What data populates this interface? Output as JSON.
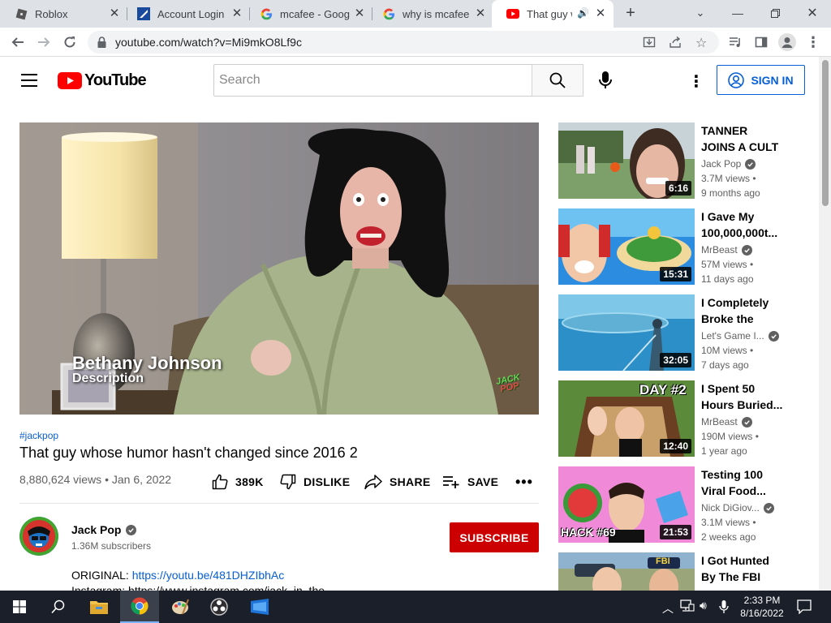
{
  "browser": {
    "tabs": [
      {
        "title": "Roblox"
      },
      {
        "title": "Account Login"
      },
      {
        "title": "mcafee - Google Search"
      },
      {
        "title": "why is mcafee o"
      },
      {
        "title": "That guy wh"
      }
    ],
    "url": "youtube.com/watch?v=Mi9mkO8Lf9c"
  },
  "header": {
    "logo_text": "YouTube",
    "search_placeholder": "Search",
    "signin_label": "SIGN IN"
  },
  "video": {
    "overlay_name": "Bethany Johnson",
    "overlay_sub": "Description",
    "watermark_top": "JACK",
    "watermark_bottom": "POP",
    "hashtag": "#jackpop",
    "title": "That guy whose humor hasn't changed since 2016 2",
    "views_date": "8,880,624 views • Jan 6, 2022",
    "likes": "389K",
    "dislike_label": "DISLIKE",
    "share_label": "SHARE",
    "save_label": "SAVE"
  },
  "channel": {
    "name": "Jack Pop",
    "subscribers": "1.36M subscribers",
    "subscribe_label": "SUBSCRIBE"
  },
  "description": {
    "line1_label": "ORIGINAL: ",
    "line1_link": "https://youtu.be/481DHZIbhAc",
    "line2": "Instagram: https://www.instagram.com/jack_in_the"
  },
  "recommended": [
    {
      "title": "TANNER JOINS A CULT",
      "channel": "Jack Pop",
      "views": "3.7M views •",
      "age": "9 months ago",
      "duration": "6:16",
      "verified": true
    },
    {
      "title": "I Gave My 100,000,000t...",
      "channel": "MrBeast",
      "views": "57M views •",
      "age": "11 days ago",
      "duration": "15:31",
      "verified": true
    },
    {
      "title": "I Completely Broke the Enti...",
      "channel": "Let's Game I...",
      "views": "10M views •",
      "age": "7 days ago",
      "duration": "32:05",
      "verified": true
    },
    {
      "title": "I Spent 50 Hours Buried...",
      "channel": "MrBeast",
      "views": "190M views •",
      "age": "1 year ago",
      "duration": "12:40",
      "verified": true,
      "thumb_text": "DAY #2"
    },
    {
      "title": "Testing 100 Viral Food...",
      "channel": "Nick DiGiov...",
      "views": "3.1M views •",
      "age": "2 weeks ago",
      "duration": "21:53",
      "verified": true,
      "thumb_text": "HACK #69"
    },
    {
      "title": "I Got Hunted By The FBI",
      "channel": "",
      "views": "",
      "age": "",
      "duration": "",
      "verified": false,
      "thumb_text": "FBI"
    }
  ],
  "taskbar": {
    "time": "2:33 PM",
    "date": "8/16/2022"
  }
}
